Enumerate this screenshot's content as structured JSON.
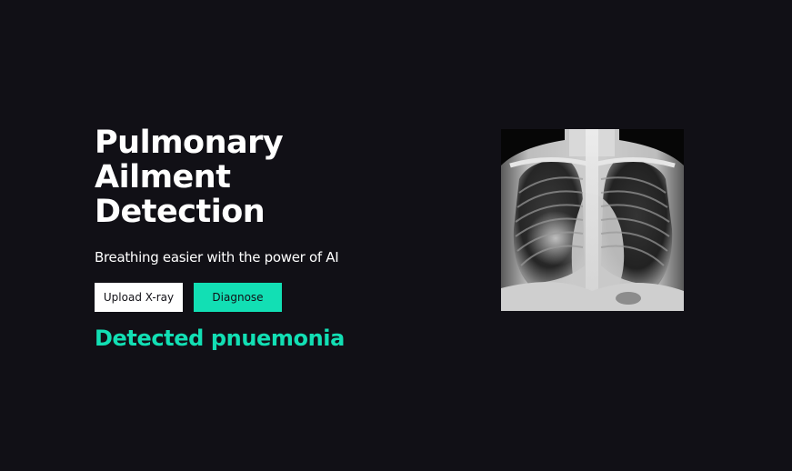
{
  "hero": {
    "title_line1": "Pulmonary",
    "title_line2": "Ailment",
    "title_line3": "Detection",
    "subtitle": "Breathing easier with the power of AI"
  },
  "actions": {
    "upload_label": "Upload X-ray",
    "diagnose_label": "Diagnose"
  },
  "result": {
    "text": "Detected pnuemonia"
  },
  "colors": {
    "background": "#111016",
    "accent": "#12dfb4",
    "text": "#ffffff"
  }
}
